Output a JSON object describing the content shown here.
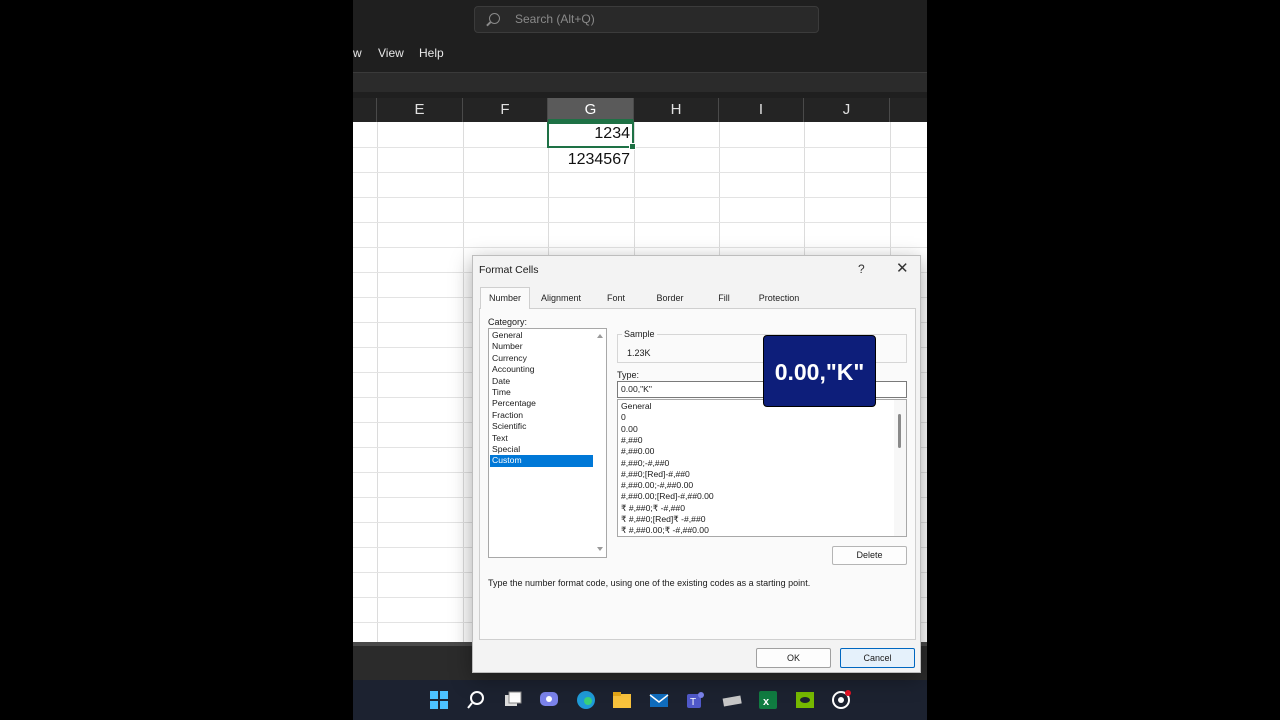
{
  "excel": {
    "search_placeholder": "Search (Alt+Q)",
    "menu": [
      "w",
      "View",
      "Help"
    ],
    "columns": [
      "E",
      "F",
      "G",
      "H",
      "I",
      "J"
    ],
    "selected_column": "G",
    "cells": {
      "G1": "1234",
      "G2": "1234567"
    }
  },
  "dialog": {
    "title": "Format Cells",
    "help": "?",
    "close": "✕",
    "tabs": [
      "Number",
      "Alignment",
      "Font",
      "Border",
      "Fill",
      "Protection"
    ],
    "active_tab": "Number",
    "category_label": "Category:",
    "categories": [
      "General",
      "Number",
      "Currency",
      "Accounting",
      "Date",
      "Time",
      "Percentage",
      "Fraction",
      "Scientific",
      "Text",
      "Special",
      "Custom"
    ],
    "selected_category": "Custom",
    "sample_label": "Sample",
    "sample_value": "1.23K",
    "type_label": "Type:",
    "type_value": "0.00,\"K\"",
    "types": [
      "General",
      "0",
      "0.00",
      "#,##0",
      "#,##0.00",
      "#,##0;-#,##0",
      "#,##0;[Red]-#,##0",
      "#,##0.00;-#,##0.00",
      "#,##0.00;[Red]-#,##0.00",
      "₹ #,##0;₹ -#,##0",
      "₹ #,##0;[Red]₹ -#,##0",
      "₹ #,##0.00;₹ -#,##0.00"
    ],
    "delete_label": "Delete",
    "hint": "Type the number format code, using one of the existing codes as a starting point.",
    "ok_label": "OK",
    "cancel_label": "Cancel"
  },
  "callout": {
    "text": "0.00,\"K\""
  },
  "taskbar": {
    "icons": [
      "windows-start-icon",
      "search-icon",
      "task-view-icon",
      "chat-icon",
      "edge-icon",
      "file-explorer-icon",
      "mail-icon",
      "teams-icon",
      "app-icon",
      "excel-icon",
      "nvidia-icon",
      "chrome-icon"
    ]
  },
  "colors": {
    "excel_green": "#1e7145",
    "callout_bg": "#0d1e7a",
    "selection_blue": "#0078d7"
  }
}
